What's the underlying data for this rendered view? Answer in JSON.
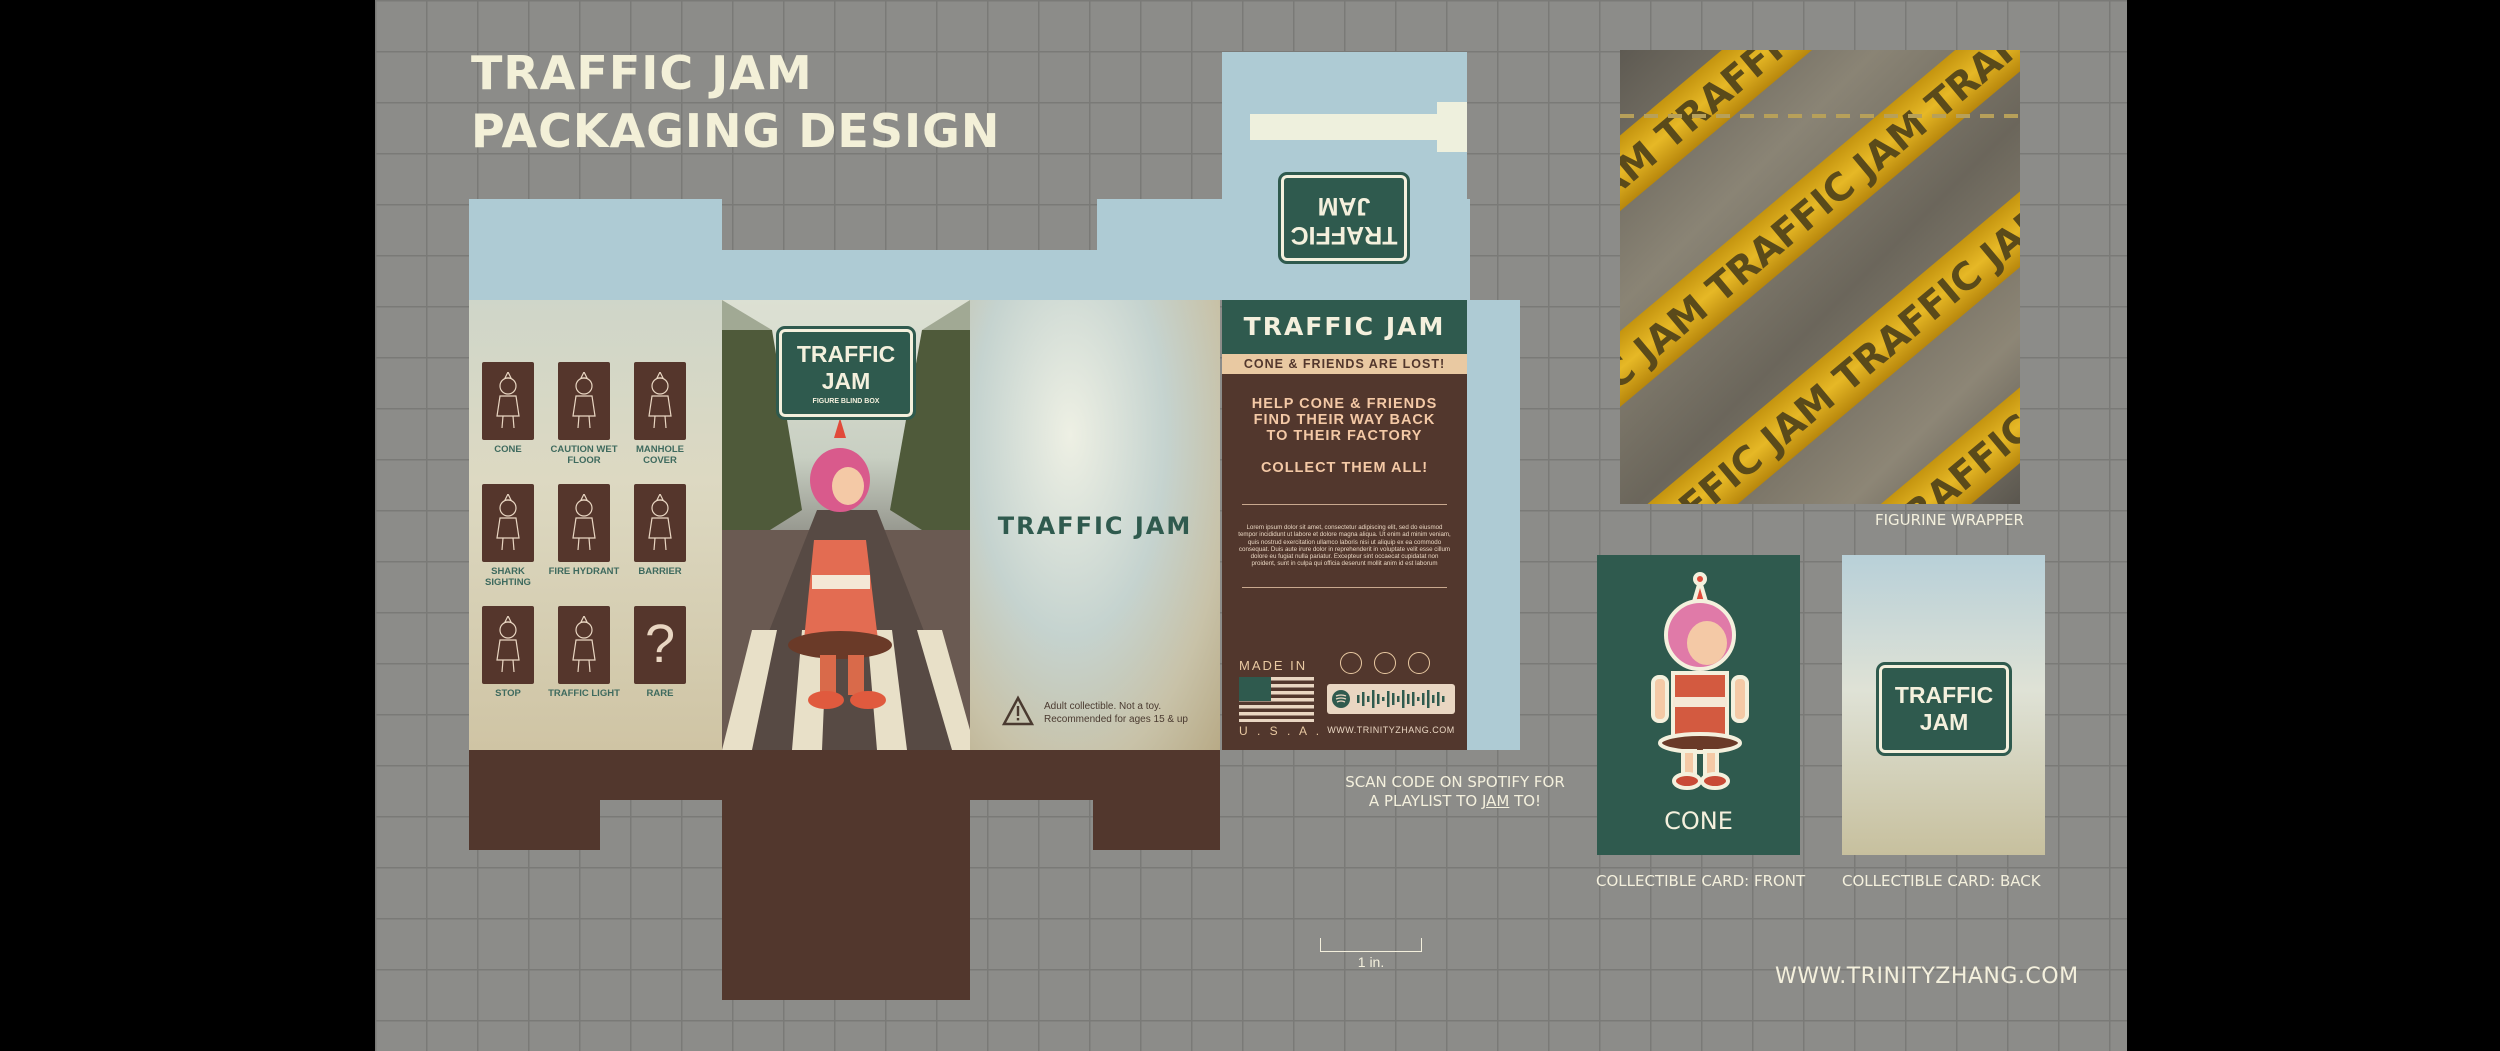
{
  "title": {
    "line1": "TRAFFIC JAM",
    "line2": "PACKAGING DESIGN"
  },
  "figures_grid": [
    {
      "label": "CONE"
    },
    {
      "label": "CAUTION WET FLOOR"
    },
    {
      "label": "MANHOLE COVER"
    },
    {
      "label": "SHARK SIGHTING"
    },
    {
      "label": "FIRE HYDRANT"
    },
    {
      "label": "BARRIER"
    },
    {
      "label": "STOP"
    },
    {
      "label": "TRAFFIC LIGHT"
    },
    {
      "label": "RARE",
      "glyph": "?"
    }
  ],
  "front": {
    "sign_line1": "TRAFFIC",
    "sign_line2": "JAM",
    "sign_sub": "FIGURE BLIND BOX"
  },
  "side": {
    "logo": "TRAFFIC JAM",
    "warning_line1": "Adult collectible. Not a toy.",
    "warning_line2": "Recommended for ages 15 & up",
    "warning_icon": "warning-triangle-icon"
  },
  "top_flap": {
    "sign_line1": "TRAFFIC",
    "sign_line2": "JAM"
  },
  "back": {
    "header": "TRAFFIC JAM",
    "banner": "CONE & FRIENDS ARE LOST!",
    "pitch_line1": "HELP CONE & FRIENDS",
    "pitch_line2": "FIND THEIR WAY BACK",
    "pitch_line3": "TO THEIR FACTORY",
    "collect": "COLLECT THEM ALL!",
    "lorem": "Lorem ipsum dolor sit amet, consectetur adipiscing elit, sed do eiusmod tempor incididunt ut labore et dolore magna aliqua. Ut enim ad minim veniam, quis nostrud exercitation ullamco laboris nisi ut aliquip ex ea commodo consequat. Duis aute irure dolor in reprehenderit in voluptate velit esse cillum dolore eu fugiat nulla pariatur. Excepteur sint occaecat cupidatat non proident, sunt in culpa qui officia deserunt mollit anim id est laborum",
    "made_in": "MADE IN",
    "usa": "U . S . A .",
    "website": "WWW.TRINITYZHANG.COM",
    "flag_icon": "us-flag-icon",
    "spotify_icon": "spotify-code-icon"
  },
  "spotify_note": {
    "line1": "SCAN CODE ON SPOTIFY FOR",
    "line2_pre": "A PLAYLIST TO ",
    "line2_link": "JAM",
    "line2_post": " TO!"
  },
  "scale": {
    "label": "1 in."
  },
  "wrapper": {
    "pattern_text": "TRAFFIC JAM TRAFFIC JAM TRAFFIC JAM",
    "caption": "FIGURINE WRAPPER"
  },
  "card_front": {
    "name": "CONE",
    "caption": "COLLECTIBLE CARD: FRONT"
  },
  "card_back": {
    "sign_line1": "TRAFFIC",
    "sign_line2": "JAM",
    "caption": "COLLECTIBLE CARD: BACK"
  },
  "footer": {
    "website": "WWW.TRINITYZHANG.COM"
  },
  "colors": {
    "board": "#8c8c89",
    "green": "#2f5a4e",
    "brown": "#52372d",
    "cream": "#f4f0dd",
    "sky": "#aecbd4",
    "tape_yellow": "#d9a91a"
  }
}
